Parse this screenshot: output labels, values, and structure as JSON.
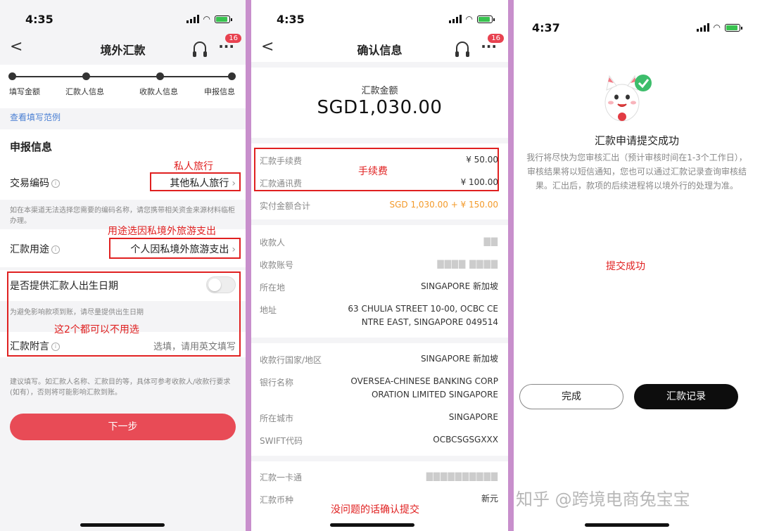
{
  "screen1": {
    "time": "4:35",
    "nav_back": "<",
    "title": "境外汇款",
    "more": "···",
    "badge": "16",
    "steps": [
      "填写金额",
      "汇款人信息",
      "收款人信息",
      "申报信息"
    ],
    "example_link": "查看填写范例",
    "section_title": "申报信息",
    "trade_code_label": "交易编码",
    "trade_code_value": "其他私人旅行",
    "trade_code_hint": "如在本渠道无法选择您需要的编码名称，请您携带相关资金来源材料临柜办理。",
    "purpose_label": "汇款用途",
    "purpose_value": "个人因私境外旅游支出",
    "birth_label": "是否提供汇款人出生日期",
    "birth_hint": "为避免影响款项到账，请尽量提供出生日期",
    "remark_label": "汇款附言",
    "remark_placeholder": "选填，请用英文填写",
    "bottom_hint": "建议填写。如汇款人名称、汇款目的等，具体可参考收款人/收款行要求(如有），否则将可能影响汇款到账。",
    "next_button": "下一步",
    "annotations": {
      "a1": "私人旅行",
      "a2": "用途选因私境外旅游支出",
      "a3": "这2个都可以不用选"
    }
  },
  "screen2": {
    "time": "4:35",
    "nav_back": "<",
    "title": "确认信息",
    "more": "···",
    "badge": "16",
    "amount_label": "汇款金额",
    "amount_value": "SGD1,030.00",
    "fee_label": "汇款手续费",
    "fee_value": "¥ 50.00",
    "telecom_label": "汇款通讯费",
    "telecom_value": "¥ 100.00",
    "total_label": "实付金额合计",
    "total_value": "SGD 1,030.00 + ¥ 150.00",
    "payee_label": "收款人",
    "payee_value": "▇▇",
    "account_label": "收款账号",
    "account_value": "▇▇▇▇ ▇▇▇▇",
    "location_label": "所在地",
    "location_value": "SINGAPORE 新加坡",
    "address_label": "地址",
    "address_line1": "63 CHULIA STREET 10-00, OCBC CE",
    "address_line2": "NTRE EAST, SINGAPORE 049514",
    "bank_country_label": "收款行国家/地区",
    "bank_country_value": "SINGAPORE 新加坡",
    "bank_name_label": "银行名称",
    "bank_name_line1": "OVERSEA-CHINESE BANKING CORP",
    "bank_name_line2": "ORATION LIMITED SINGAPORE",
    "city_label": "所在城市",
    "city_value": "SINGAPORE",
    "swift_label": "SWIFT代码",
    "swift_value": "OCBCSGSGXXX",
    "card_label": "汇款一卡通",
    "card_value": "▇▇▇▇▇▇▇▇▇▇",
    "currency_label": "汇款币种",
    "currency_value": "新元",
    "annotations": {
      "fee": "手续费",
      "confirm": "没问题的话确认提交"
    }
  },
  "screen3": {
    "time": "4:37",
    "title": "汇款申请提交成功",
    "description": "我行将尽快为您审核汇出（预计审核时间在1-3个工作日），审核结果将以短信通知，您也可以通过汇款记录查询审核结果。汇出后，款项的后续进程将以境外行的处理为准。",
    "annotation": "提交成功",
    "done_button": "完成",
    "records_button": "汇款记录",
    "watermark": "知乎 @跨境电商兔宝宝"
  },
  "colors": {
    "accent_red": "#e84b56",
    "annotation_red": "#e02020",
    "orange": "#f39a2a",
    "link_blue": "#4a7fd3",
    "divider_purple": "#c88fcc"
  }
}
